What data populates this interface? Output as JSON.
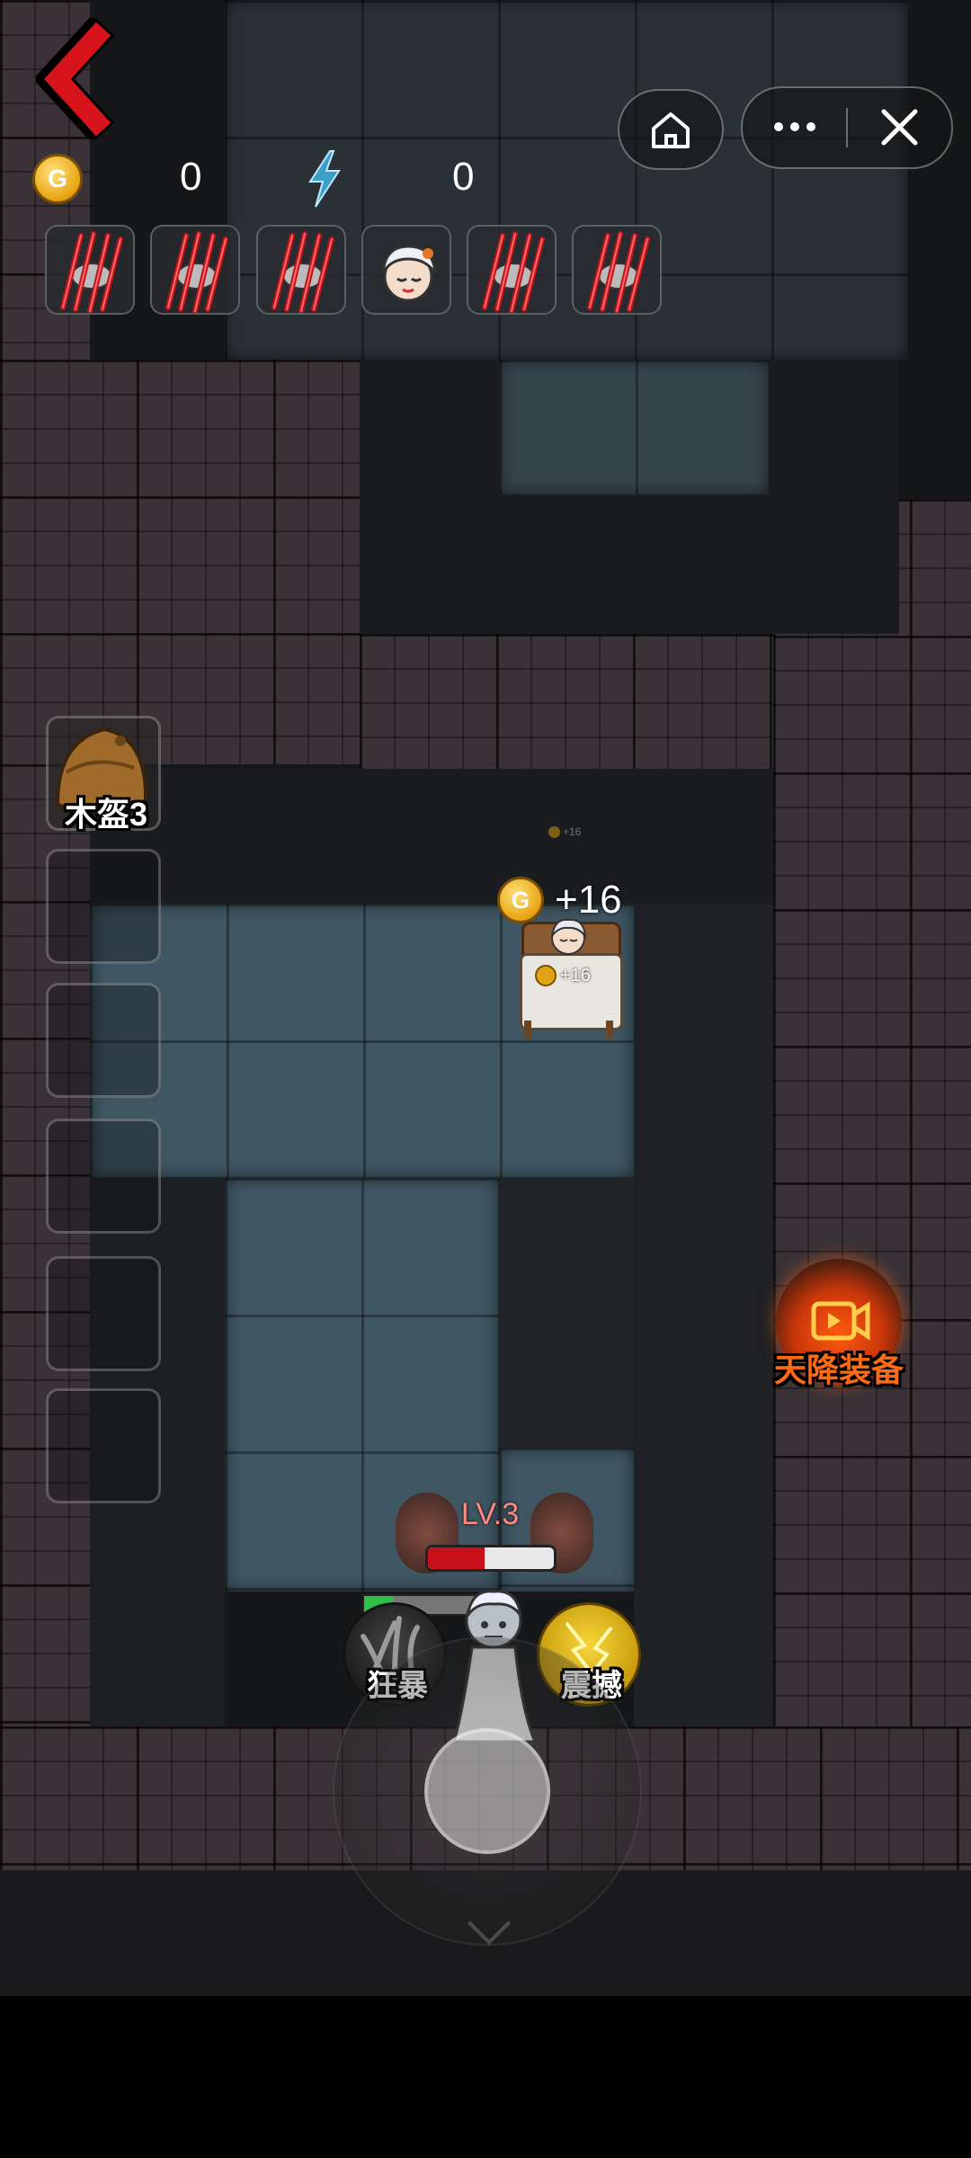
{
  "hud": {
    "gold_coin_letter": "G",
    "gold_value": "0",
    "energy_icon": "lightning-icon",
    "energy_value": "0"
  },
  "slots": [
    {
      "icon": "clawed-enemy-icon"
    },
    {
      "icon": "clawed-enemy-icon"
    },
    {
      "icon": "clawed-enemy-icon"
    },
    {
      "icon": "grandma-portrait-icon"
    },
    {
      "icon": "clawed-enemy-icon"
    },
    {
      "icon": "clawed-enemy-icon"
    }
  ],
  "side_items": {
    "first_label": "木盔3"
  },
  "bed": {
    "gain_text": "+16",
    "small_gain": "+16",
    "faint_gain": "+16"
  },
  "door": {
    "level_label": "LV.3",
    "health_fraction": 0.45
  },
  "skills": {
    "left_label": "狂暴",
    "right_label": "震撼"
  },
  "ad_button": {
    "label": "天降装备"
  },
  "colors": {
    "back_arrow": "#d7141b",
    "health_red": "#c8101a",
    "ad_orange": "#ff6a13",
    "skill_gold": "#f3cf1a"
  }
}
